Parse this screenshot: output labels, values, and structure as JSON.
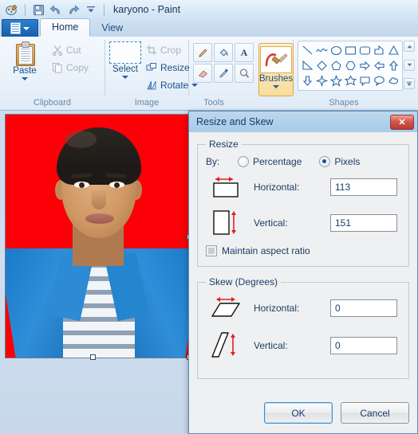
{
  "window": {
    "title": "karyono - Paint",
    "quick_access": [
      "paint-app-icon",
      "save-icon",
      "undo-icon",
      "redo-icon",
      "customize-qat-icon"
    ]
  },
  "tabs": [
    {
      "label": "Home",
      "active": true
    },
    {
      "label": "View",
      "active": false
    }
  ],
  "ribbon": {
    "clipboard": {
      "group_label": "Clipboard",
      "paste_label": "Paste",
      "cut_label": "Cut",
      "copy_label": "Copy"
    },
    "image": {
      "group_label": "Image",
      "select_label": "Select",
      "crop_label": "Crop",
      "resize_label": "Resize",
      "rotate_label": "Rotate"
    },
    "tools": {
      "group_label": "Tools",
      "items": [
        "pencil-icon",
        "fill-icon",
        "text-icon",
        "eraser-icon",
        "color-picker-icon",
        "magnifier-icon"
      ],
      "brushes_label": "Brushes"
    },
    "shapes": {
      "group_label": "Shapes",
      "items": [
        "line-shape",
        "curve-shape",
        "oval-shape",
        "rectangle-shape",
        "rounded-rectangle-shape",
        "polygon-shape",
        "triangle-shape",
        "right-triangle-shape",
        "diamond-shape",
        "pentagon-shape",
        "hexagon-shape",
        "right-arrow-shape",
        "left-arrow-shape",
        "up-arrow-shape",
        "down-arrow-shape",
        "four-point-star-shape",
        "five-point-star-shape",
        "six-point-star-shape",
        "rounded-callout-shape",
        "oval-callout-shape",
        "cloud-callout-shape"
      ],
      "scroll_up": "▲",
      "scroll_down": "▼",
      "scroll_more": "▼"
    }
  },
  "canvas": {
    "image_alt": "portrait photo on red background",
    "background_color": "#ff0000"
  },
  "dialog": {
    "title": "Resize and Skew",
    "close_label": "✕",
    "resize": {
      "legend": "Resize",
      "by_label": "By:",
      "percentage_label": "Percentage",
      "percentage_selected": false,
      "pixels_label": "Pixels",
      "pixels_selected": true,
      "horizontal_label": "Horizontal:",
      "horizontal_value": "113",
      "vertical_label": "Vertical:",
      "vertical_value": "151",
      "maintain_label": "Maintain aspect ratio",
      "maintain_checked": false
    },
    "skew": {
      "legend": "Skew (Degrees)",
      "horizontal_label": "Horizontal:",
      "horizontal_value": "0",
      "vertical_label": "Vertical:",
      "vertical_value": "0"
    },
    "ok_label": "OK",
    "cancel_label": "Cancel"
  },
  "colors": {
    "accent": "#15539b",
    "canvas_red": "#ff0000",
    "close_red": "#d2564b",
    "brush_highlight": "#f7dd9e"
  }
}
